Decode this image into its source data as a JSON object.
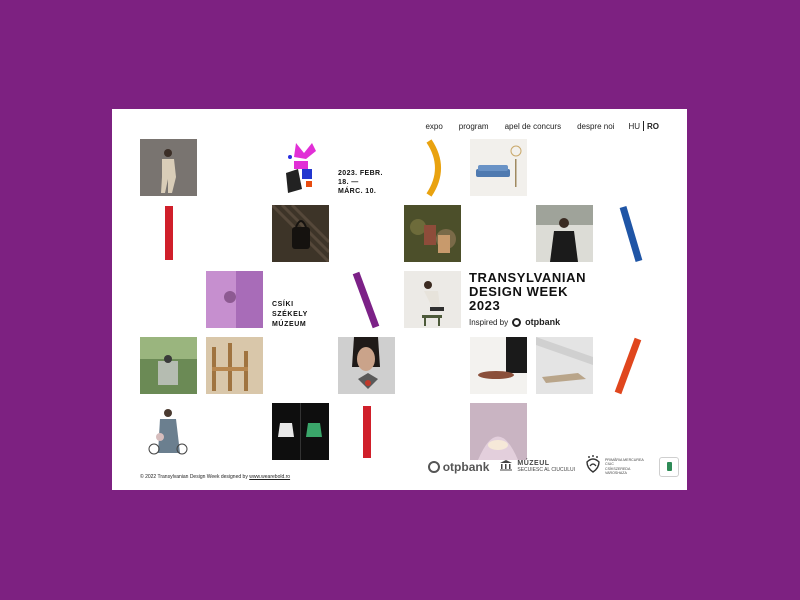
{
  "nav": {
    "links": [
      "expo",
      "program",
      "apel de concurs",
      "despre noi"
    ],
    "lang_hu": "HU",
    "lang_ro": "RO"
  },
  "event": {
    "dates": "2023. FEBR.\n18. —\nMÁRC. 10.",
    "museum_lines": [
      "CSÍKI",
      "SZÉKELY",
      "MÚZEUM"
    ],
    "title_lines": [
      "TRANSYLVANIAN",
      "DESIGN WEEK",
      "2023"
    ],
    "inspired_by": "Inspired by",
    "sponsor_name": "otpbank"
  },
  "footer": {
    "copyright": "© 2022 Transylvanian Design Week designed by",
    "designer_link": "www.wearebold.ro"
  },
  "sponsors": {
    "otp": "otpbank",
    "museum_name": "MÚZEUL",
    "museum_sub": "SECUIESC AL CIUCULUI",
    "city_line1": "PRIMĂRIA MERCUREA CIUC",
    "city_line2": "CSÍKSZEREDA VAROSHAZA"
  },
  "colors": {
    "background": "#7d2181",
    "red": "#d01f2a",
    "blue": "#1f55a6",
    "purple": "#7c2187",
    "orange": "#e0461d",
    "yellow": "#e9a20f"
  }
}
